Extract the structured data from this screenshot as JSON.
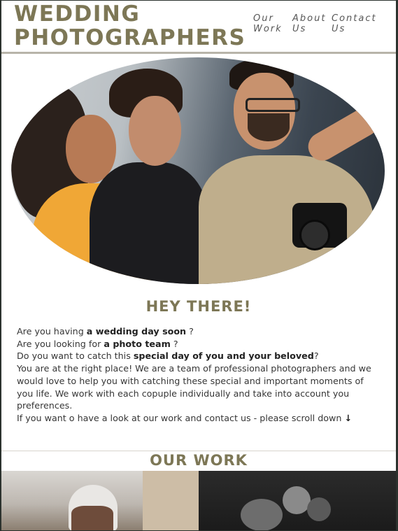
{
  "header": {
    "brand": "WEDDING PHOTOGRAPHERS",
    "nav": [
      {
        "label": "Our Work"
      },
      {
        "label": "About Us"
      },
      {
        "label": "Contact Us"
      }
    ]
  },
  "colors": {
    "brand": "#7d7756",
    "text": "#363636",
    "page_border": "#2c322e"
  },
  "hero": {
    "image": "photographers-team-photo"
  },
  "intro": {
    "title": "HEY THERE!",
    "q1_pre": "Are you having ",
    "q1_bold": "a wedding day soon",
    "q1_post": " ?",
    "q2_pre": "Are you looking for ",
    "q2_bold": "a photo team",
    "q2_post": " ?",
    "q3_pre": "Do you want to catch this ",
    "q3_bold": "special day of you and your beloved",
    "q3_post": "?",
    "p1": "You are at the right place! We are a team of professional photographers and we would love to help you with catching these special and important moments of you life. We work with each copuple individually and take into account you preferences.",
    "p2": "If you want o have a look at our work and contact us - please scroll down",
    "arrow_icon": "arrow-down-icon"
  },
  "work": {
    "title": "OUR WORK"
  }
}
